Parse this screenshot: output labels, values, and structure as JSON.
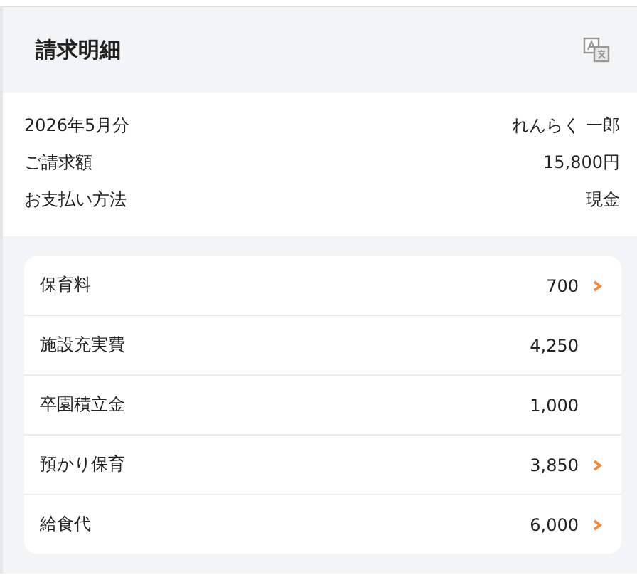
{
  "header": {
    "title": "請求明細"
  },
  "summary": [
    {
      "label": "2026年5月分",
      "value": "れんらく 一郎"
    },
    {
      "label": "ご請求額",
      "value": "15,800円"
    },
    {
      "label": "お支払い方法",
      "value": "現金"
    }
  ],
  "items": [
    {
      "label": "保育料",
      "amount": "700",
      "has_detail": true
    },
    {
      "label": "施設充実費",
      "amount": "4,250",
      "has_detail": false
    },
    {
      "label": "卒園積立金",
      "amount": "1,000",
      "has_detail": false
    },
    {
      "label": "預かり保育",
      "amount": "3,850",
      "has_detail": true
    },
    {
      "label": "給食代",
      "amount": "6,000",
      "has_detail": true
    }
  ]
}
